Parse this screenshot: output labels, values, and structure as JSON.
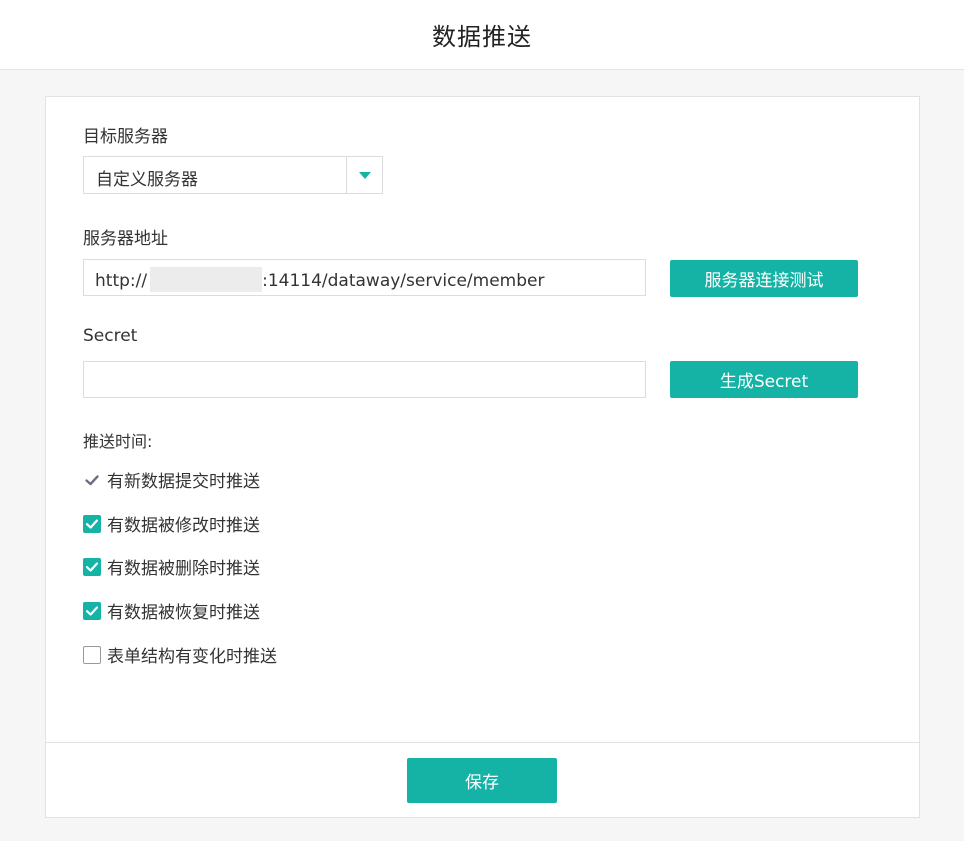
{
  "header": {
    "title": "数据推送"
  },
  "form": {
    "target_server": {
      "label": "目标服务器",
      "selected": "自定义服务器",
      "arrow_icon": "caret-down-icon"
    },
    "server_address": {
      "label": "服务器地址",
      "value_prefix": "http://",
      "value_suffix": ":14114/dataway/service/member",
      "test_button_label": "服务器连接测试"
    },
    "secret": {
      "label": "Secret",
      "value": "",
      "generate_button_label": "生成Secret"
    },
    "push_time": {
      "label": "推送时间:",
      "options": [
        {
          "label": "有新数据提交时推送",
          "checked": true,
          "disabled": true
        },
        {
          "label": "有数据被修改时推送",
          "checked": true,
          "disabled": false
        },
        {
          "label": "有数据被删除时推送",
          "checked": true,
          "disabled": false
        },
        {
          "label": "有数据被恢复时推送",
          "checked": true,
          "disabled": false
        },
        {
          "label": "表单结构有变化时推送",
          "checked": false,
          "disabled": false
        }
      ]
    },
    "save_label": "保存"
  },
  "colors": {
    "accent": "#14b3a5",
    "disabled_check": "#6b7080",
    "background": "#f6f6f6",
    "border": "#dcdcdc"
  }
}
